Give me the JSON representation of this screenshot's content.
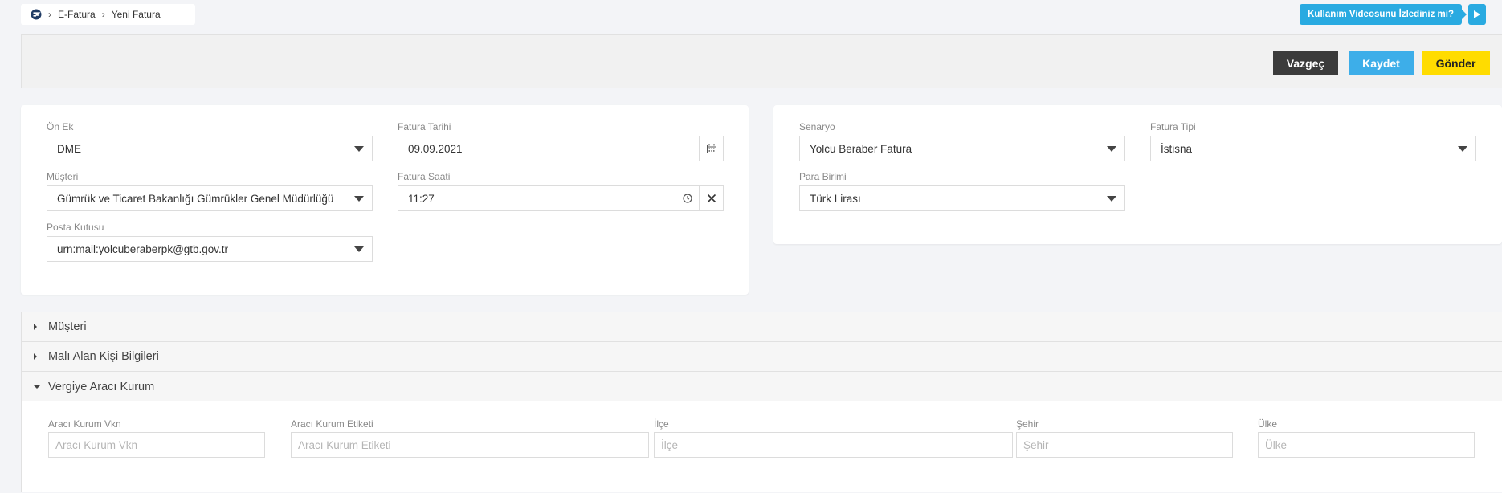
{
  "breadcrumb": {
    "items": [
      "E-Fatura",
      "Yeni Fatura"
    ]
  },
  "help_video": {
    "label": "Kullanım Videosunu İzlediniz mi?"
  },
  "toolbar": {
    "cancel_label": "Vazgeç",
    "save_label": "Kaydet",
    "send_label": "Gönder"
  },
  "invoice_form": {
    "prefix": {
      "label": "Ön Ek",
      "value": "DME"
    },
    "invoice_date": {
      "label": "Fatura Tarihi",
      "value": "09.09.2021"
    },
    "customer": {
      "label": "Müşteri",
      "value": "Gümrük ve Ticaret Bakanlığı Gümrükler Genel Müdürlüğü"
    },
    "invoice_time": {
      "label": "Fatura Saati",
      "value": "11:27"
    },
    "mailbox": {
      "label": "Posta Kutusu",
      "value": "urn:mail:yolcuberaberpk@gtb.gov.tr"
    }
  },
  "scenario_form": {
    "scenario": {
      "label": "Senaryo",
      "value": "Yolcu Beraber Fatura"
    },
    "invoice_type": {
      "label": "Fatura Tipi",
      "value": "İstisna"
    },
    "currency": {
      "label": "Para Birimi",
      "value": "Türk Lirası"
    }
  },
  "accordion": {
    "sections": [
      {
        "title": "Müşteri",
        "expanded": false
      },
      {
        "title": "Malı Alan Kişi Bilgileri",
        "expanded": false
      },
      {
        "title": "Vergiye Aracı Kurum",
        "expanded": true
      }
    ],
    "fields": {
      "vkn": {
        "label": "Aracı Kurum Vkn",
        "placeholder": "Aracı Kurum Vkn"
      },
      "tag": {
        "label": "Aracı Kurum Etiketi",
        "placeholder": "Aracı Kurum Etiketi"
      },
      "district": {
        "label": "İlçe",
        "placeholder": "İlçe"
      },
      "city": {
        "label": "Şehir",
        "placeholder": "Şehir"
      },
      "country": {
        "label": "Ülke",
        "placeholder": "Ülke"
      }
    }
  },
  "colors": {
    "accent_blue": "#3daee9",
    "send_yellow": "#ffdc00",
    "cancel_dark": "#3b3b3b",
    "help_blue": "#29aae1"
  }
}
